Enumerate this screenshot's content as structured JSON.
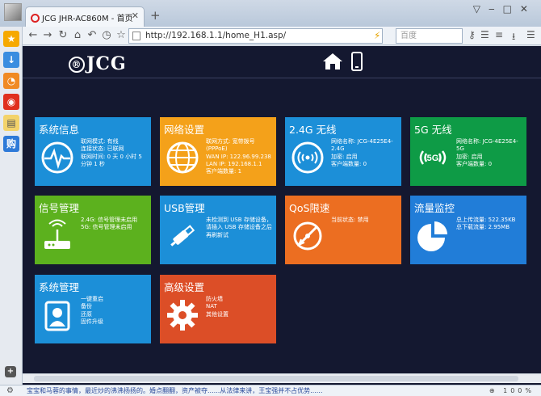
{
  "browser": {
    "tab_title": "JCG JHR-AC860M - 首页",
    "new_tab": "+",
    "url": "http://192.168.1.1/home_H1.asp/",
    "search_placeholder": "百度",
    "zoom": "100%",
    "status_message": "宝宝和马蓉的事情，最近炒的沸沸扬扬的。婚点翻翻，资产被夺......从法律来讲，王宝强并不占优势......"
  },
  "header": {
    "logo": "JCG",
    "logo_mark": "®"
  },
  "tiles": [
    {
      "id": "system-info",
      "title": "系统信息",
      "color": "#1c8fd8",
      "icon": "pulse-icon",
      "lines": [
        "联网模式: 有线",
        "连接状态: 已联网",
        "联网时间: 0 天 0 小时 5 分钟 1 秒"
      ]
    },
    {
      "id": "network-settings",
      "title": "网络设置",
      "color": "#f4a11a",
      "icon": "globe-icon",
      "lines": [
        "联网方式: 宽带拨号(PPPoE)",
        "WAN IP: 122.96.99.238",
        "LAN IP: 192.168.1.1",
        "客户端数量: 1"
      ]
    },
    {
      "id": "wifi-24g",
      "title": "2.4G 无线",
      "color": "#1c8fd8",
      "icon": "wifi-icon",
      "lines": [
        "网络名称: JCG-4E25E4-2.4G",
        "加密: 启用",
        "客户端数量: 0"
      ]
    },
    {
      "id": "wifi-5g",
      "title": "5G 无线",
      "color": "#0e9b46",
      "icon": "wifi-5g-icon",
      "lines": [
        "网络名称: JCG-4E25E4-5G",
        "加密: 启用",
        "客户端数量: 0"
      ]
    },
    {
      "id": "signal-management",
      "title": "信号管理",
      "color": "#5cb11e",
      "icon": "router-icon",
      "lines": [
        "2.4G: 信号管理未启用",
        "5G: 信号管理未启用"
      ]
    },
    {
      "id": "usb-management",
      "title": "USB管理",
      "color": "#1c8fd8",
      "icon": "usb-icon",
      "lines": [
        "未检测到 USB 存储设备，请插入 USB 存储设备之后再刷新试"
      ]
    },
    {
      "id": "qos",
      "title": "QoS限速",
      "color": "#ec6e21",
      "icon": "qos-icon",
      "lines": [
        "当前状态: 禁用"
      ]
    },
    {
      "id": "traffic-monitor",
      "title": "流量监控",
      "color": "#217dd8",
      "icon": "pie-chart-icon",
      "lines": [
        "总上传流量: 522.35KB",
        "总下载流量: 2.95MB"
      ]
    },
    {
      "id": "system-management",
      "title": "系统管理",
      "color": "#1c8fd8",
      "icon": "contacts-icon",
      "lines": [
        "一键重启",
        "备份",
        "还原",
        "固件升级"
      ]
    },
    {
      "id": "advanced-settings",
      "title": "高级设置",
      "color": "#dc4e27",
      "icon": "gear-icon",
      "lines": [
        "防火墙",
        "NAT",
        "其他设置"
      ]
    }
  ]
}
